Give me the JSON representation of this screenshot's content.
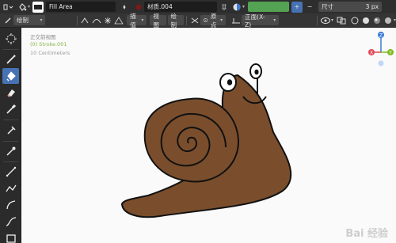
{
  "header": {
    "mode_label": "绘制",
    "fill_label": "Fill Area",
    "material_label": "材质.004",
    "size_label": "尺寸",
    "size_value": "3 px"
  },
  "subheader": {
    "mode": "绘制",
    "stroke_placement": "描值",
    "menus": [
      "视图",
      "绘制"
    ],
    "origin": "原点",
    "orientation": "正面(X-Z)"
  },
  "viewport": {
    "view_name": "正交前视图",
    "object_name": "(0) Stroke.001",
    "scale": "10 Centimeters",
    "gizmo": {
      "x": "X",
      "y": "Y",
      "z": "Z"
    }
  },
  "watermark": "Bai 经验",
  "colors": {
    "active_tool": "#4772b3",
    "material_swatch": "#54a254",
    "snail_fill": "#7a4e2c",
    "gizmo_z": "#3d7bd6",
    "gizmo_x": "#e34554",
    "gizmo_y": "#7cbb1c"
  },
  "tools": [
    "cursor-icon",
    "draw-icon",
    "fill-icon",
    "erase-icon",
    "tint-icon",
    "cutter-icon",
    "eyedropper-icon",
    "line-icon",
    "polyline-icon",
    "arc-icon",
    "curve-icon",
    "box-icon"
  ]
}
